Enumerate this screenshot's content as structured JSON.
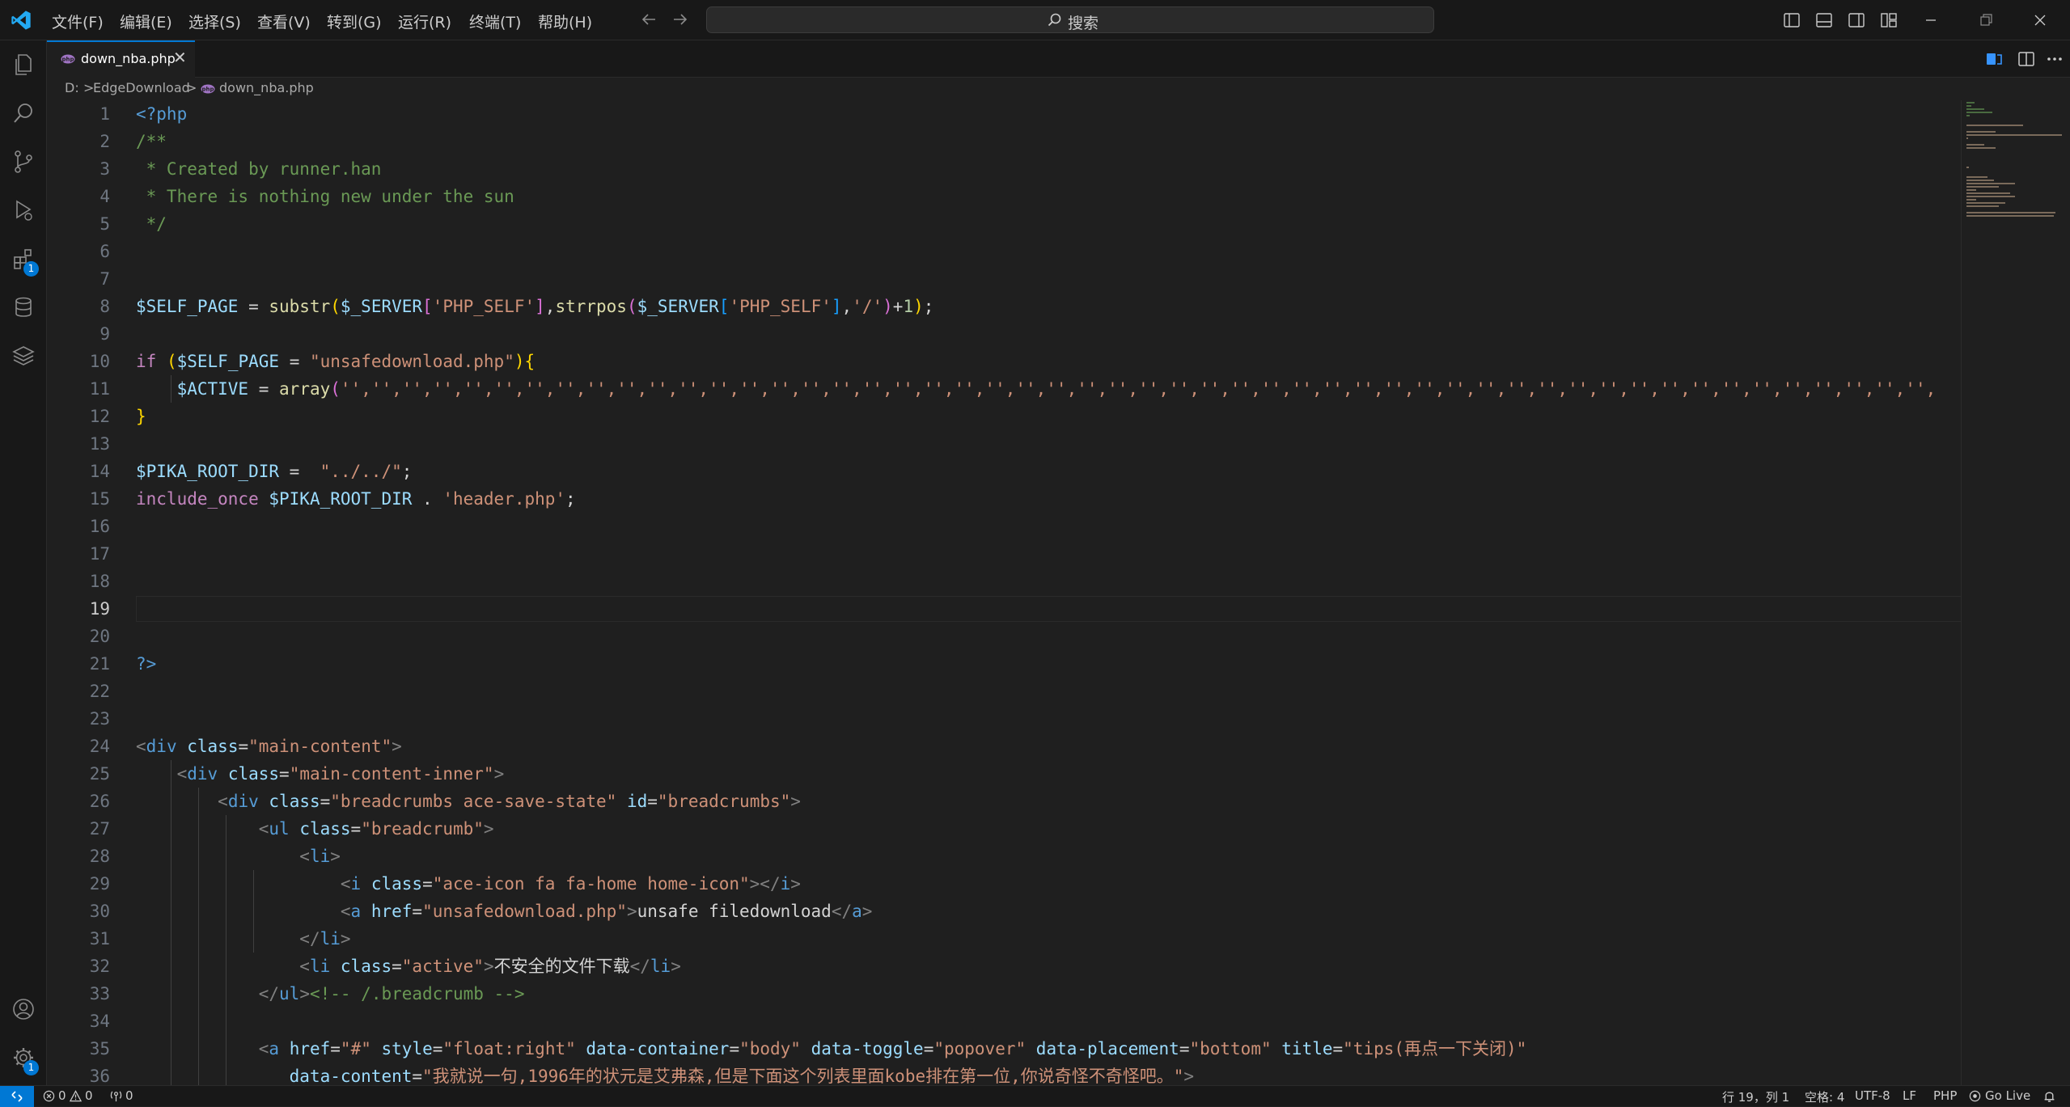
{
  "menu": [
    "文件(F)",
    "编辑(E)",
    "选择(S)",
    "查看(V)",
    "转到(G)",
    "运行(R)",
    "终端(T)",
    "帮助(H)"
  ],
  "search": {
    "label": "搜索"
  },
  "tab": {
    "label": "down_nba.php",
    "close": "✕"
  },
  "breadcrumb": {
    "drive": "D:",
    "folder": "EdgeDownload",
    "file": "down_nba.php",
    "sep": ">"
  },
  "activity": {
    "extensions_badge": "1",
    "settings_badge": "1"
  },
  "editor": {
    "current_line": 19,
    "line_numbers": [
      "1",
      "2",
      "3",
      "4",
      "5",
      "6",
      "7",
      "8",
      "9",
      "10",
      "11",
      "12",
      "13",
      "14",
      "15",
      "16",
      "17",
      "18",
      "19",
      "20",
      "21",
      "22",
      "23",
      "24",
      "25",
      "26",
      "27",
      "28",
      "29",
      "30",
      "31",
      "32",
      "33",
      "34",
      "35",
      "36"
    ],
    "lines": [
      [
        [
          "<?php",
          "#569cd6"
        ]
      ],
      [
        [
          "/**",
          "#6a9955"
        ]
      ],
      [
        [
          " * Created by runner.han",
          "#6a9955"
        ]
      ],
      [
        [
          " * There is nothing new under the sun",
          "#6a9955"
        ]
      ],
      [
        [
          " */",
          "#6a9955"
        ]
      ],
      [],
      [],
      [
        [
          "$SELF_PAGE",
          "#9cdcfe"
        ],
        [
          " = ",
          "#d4d4d4"
        ],
        [
          "substr",
          "#dcdcaa"
        ],
        [
          "(",
          "#ffd700"
        ],
        [
          "$_SERVER",
          "#9cdcfe"
        ],
        [
          "[",
          "#da70d6"
        ],
        [
          "'PHP_SELF'",
          "#ce9178"
        ],
        [
          "]",
          "#da70d6"
        ],
        [
          ",",
          "#d4d4d4"
        ],
        [
          "strrpos",
          "#dcdcaa"
        ],
        [
          "(",
          "#da70d6"
        ],
        [
          "$_SERVER",
          "#9cdcfe"
        ],
        [
          "[",
          "#179fff"
        ],
        [
          "'PHP_SELF'",
          "#ce9178"
        ],
        [
          "]",
          "#179fff"
        ],
        [
          ",",
          "#d4d4d4"
        ],
        [
          "'/'",
          "#ce9178"
        ],
        [
          ")",
          "#da70d6"
        ],
        [
          "+",
          "#d4d4d4"
        ],
        [
          "1",
          "#b5cea8"
        ],
        [
          ")",
          "#ffd700"
        ],
        [
          ";",
          "#d4d4d4"
        ]
      ],
      [],
      [
        [
          "if",
          "#c586c0"
        ],
        [
          " ",
          "#d4d4d4"
        ],
        [
          "(",
          "#ffd700"
        ],
        [
          "$SELF_PAGE",
          "#9cdcfe"
        ],
        [
          " = ",
          "#d4d4d4"
        ],
        [
          "\"unsafedownload.php\"",
          "#ce9178"
        ],
        [
          ")",
          "#ffd700"
        ],
        [
          "{",
          "#ffd700"
        ]
      ],
      [
        [
          "    ",
          "#d4d4d4"
        ],
        [
          "$ACTIVE",
          "#9cdcfe"
        ],
        [
          " = ",
          "#d4d4d4"
        ],
        [
          "array",
          "#dcdcaa"
        ],
        [
          "(",
          "#da70d6"
        ],
        [
          "'','','','','','','','','','','','','','','','','','','','','','','','','','','','','','','','','','','','','','','','','','','','','','','','','','','','',",
          "#ce9178"
        ]
      ],
      [
        [
          "}",
          "#ffd700"
        ]
      ],
      [],
      [
        [
          "$PIKA_ROOT_DIR",
          "#9cdcfe"
        ],
        [
          " =  ",
          "#d4d4d4"
        ],
        [
          "\"../../\"",
          "#ce9178"
        ],
        [
          ";",
          "#d4d4d4"
        ]
      ],
      [
        [
          "include_once",
          "#c586c0"
        ],
        [
          " ",
          "#d4d4d4"
        ],
        [
          "$PIKA_ROOT_DIR",
          "#9cdcfe"
        ],
        [
          " . ",
          "#d4d4d4"
        ],
        [
          "'header.php'",
          "#ce9178"
        ],
        [
          ";",
          "#d4d4d4"
        ]
      ],
      [],
      [],
      [],
      [],
      [],
      [
        [
          "?>",
          "#569cd6"
        ]
      ],
      [],
      [],
      [
        [
          "<",
          "#808080"
        ],
        [
          "div",
          "#569cd6"
        ],
        [
          " ",
          "#d4d4d4"
        ],
        [
          "class",
          "#9cdcfe"
        ],
        [
          "=",
          "#d4d4d4"
        ],
        [
          "\"main-content\"",
          "#ce9178"
        ],
        [
          ">",
          "#808080"
        ]
      ],
      [
        [
          "    ",
          "#d4d4d4"
        ],
        [
          "<",
          "#808080"
        ],
        [
          "div",
          "#569cd6"
        ],
        [
          " ",
          "#d4d4d4"
        ],
        [
          "class",
          "#9cdcfe"
        ],
        [
          "=",
          "#d4d4d4"
        ],
        [
          "\"main-content-inner\"",
          "#ce9178"
        ],
        [
          ">",
          "#808080"
        ]
      ],
      [
        [
          "        ",
          "#d4d4d4"
        ],
        [
          "<",
          "#808080"
        ],
        [
          "div",
          "#569cd6"
        ],
        [
          " ",
          "#d4d4d4"
        ],
        [
          "class",
          "#9cdcfe"
        ],
        [
          "=",
          "#d4d4d4"
        ],
        [
          "\"breadcrumbs ace-save-state\"",
          "#ce9178"
        ],
        [
          " ",
          "#d4d4d4"
        ],
        [
          "id",
          "#9cdcfe"
        ],
        [
          "=",
          "#d4d4d4"
        ],
        [
          "\"breadcrumbs\"",
          "#ce9178"
        ],
        [
          ">",
          "#808080"
        ]
      ],
      [
        [
          "            ",
          "#d4d4d4"
        ],
        [
          "<",
          "#808080"
        ],
        [
          "ul",
          "#569cd6"
        ],
        [
          " ",
          "#d4d4d4"
        ],
        [
          "class",
          "#9cdcfe"
        ],
        [
          "=",
          "#d4d4d4"
        ],
        [
          "\"breadcrumb\"",
          "#ce9178"
        ],
        [
          ">",
          "#808080"
        ]
      ],
      [
        [
          "                ",
          "#d4d4d4"
        ],
        [
          "<",
          "#808080"
        ],
        [
          "li",
          "#569cd6"
        ],
        [
          ">",
          "#808080"
        ]
      ],
      [
        [
          "                    ",
          "#d4d4d4"
        ],
        [
          "<",
          "#808080"
        ],
        [
          "i",
          "#569cd6"
        ],
        [
          " ",
          "#d4d4d4"
        ],
        [
          "class",
          "#9cdcfe"
        ],
        [
          "=",
          "#d4d4d4"
        ],
        [
          "\"ace-icon fa fa-home home-icon\"",
          "#ce9178"
        ],
        [
          "></",
          "#808080"
        ],
        [
          "i",
          "#569cd6"
        ],
        [
          ">",
          "#808080"
        ]
      ],
      [
        [
          "                    ",
          "#d4d4d4"
        ],
        [
          "<",
          "#808080"
        ],
        [
          "a",
          "#569cd6"
        ],
        [
          " ",
          "#d4d4d4"
        ],
        [
          "href",
          "#9cdcfe"
        ],
        [
          "=",
          "#d4d4d4"
        ],
        [
          "\"unsafedownload.php\"",
          "#ce9178"
        ],
        [
          ">",
          "#808080"
        ],
        [
          "unsafe filedownload",
          "#d4d4d4"
        ],
        [
          "</",
          "#808080"
        ],
        [
          "a",
          "#569cd6"
        ],
        [
          ">",
          "#808080"
        ]
      ],
      [
        [
          "                ",
          "#d4d4d4"
        ],
        [
          "</",
          "#808080"
        ],
        [
          "li",
          "#569cd6"
        ],
        [
          ">",
          "#808080"
        ]
      ],
      [
        [
          "                ",
          "#d4d4d4"
        ],
        [
          "<",
          "#808080"
        ],
        [
          "li",
          "#569cd6"
        ],
        [
          " ",
          "#d4d4d4"
        ],
        [
          "class",
          "#9cdcfe"
        ],
        [
          "=",
          "#d4d4d4"
        ],
        [
          "\"active\"",
          "#ce9178"
        ],
        [
          ">",
          "#808080"
        ],
        [
          "不安全的文件下载",
          "#d4d4d4"
        ],
        [
          "</",
          "#808080"
        ],
        [
          "li",
          "#569cd6"
        ],
        [
          ">",
          "#808080"
        ]
      ],
      [
        [
          "            ",
          "#d4d4d4"
        ],
        [
          "</",
          "#808080"
        ],
        [
          "ul",
          "#569cd6"
        ],
        [
          ">",
          "#808080"
        ],
        [
          "<!-- /.breadcrumb -->",
          "#6a9955"
        ]
      ],
      [],
      [
        [
          "            ",
          "#d4d4d4"
        ],
        [
          "<",
          "#808080"
        ],
        [
          "a",
          "#569cd6"
        ],
        [
          " ",
          "#d4d4d4"
        ],
        [
          "href",
          "#9cdcfe"
        ],
        [
          "=",
          "#d4d4d4"
        ],
        [
          "\"#\"",
          "#ce9178"
        ],
        [
          " ",
          "#d4d4d4"
        ],
        [
          "style",
          "#9cdcfe"
        ],
        [
          "=",
          "#d4d4d4"
        ],
        [
          "\"float:right\"",
          "#ce9178"
        ],
        [
          " ",
          "#d4d4d4"
        ],
        [
          "data-container",
          "#9cdcfe"
        ],
        [
          "=",
          "#d4d4d4"
        ],
        [
          "\"body\"",
          "#ce9178"
        ],
        [
          " ",
          "#d4d4d4"
        ],
        [
          "data-toggle",
          "#9cdcfe"
        ],
        [
          "=",
          "#d4d4d4"
        ],
        [
          "\"popover\"",
          "#ce9178"
        ],
        [
          " ",
          "#d4d4d4"
        ],
        [
          "data-placement",
          "#9cdcfe"
        ],
        [
          "=",
          "#d4d4d4"
        ],
        [
          "\"bottom\"",
          "#ce9178"
        ],
        [
          " ",
          "#d4d4d4"
        ],
        [
          "title",
          "#9cdcfe"
        ],
        [
          "=",
          "#d4d4d4"
        ],
        [
          "\"tips(再点一下关闭)\"",
          "#ce9178"
        ]
      ],
      [
        [
          "               ",
          "#d4d4d4"
        ],
        [
          "data-content",
          "#9cdcfe"
        ],
        [
          "=",
          "#d4d4d4"
        ],
        [
          "\"我就说一句,1996年的状元是艾弗森,但是下面这个列表里面kobe排在第一位,你说奇怪不奇怪吧。\"",
          "#ce9178"
        ],
        [
          ">",
          "#808080"
        ]
      ]
    ]
  },
  "status": {
    "errors": "0",
    "warnings": "0",
    "ports": "0",
    "position": "行 19，列 1",
    "spaces": "空格: 4",
    "encoding": "UTF-8",
    "eol": "LF",
    "language": "PHP",
    "golive": "Go Live"
  },
  "colors": {
    "accent": "#0078d4",
    "editor_bg": "#1f1f1f",
    "chrome_bg": "#181818"
  },
  "icons": [
    "vscode-logo-icon",
    "back-arrow-icon",
    "forward-arrow-icon",
    "search-icon",
    "toggle-primary-sidebar-icon",
    "toggle-panel-icon",
    "toggle-secondary-sidebar-icon",
    "customize-layout-icon",
    "minimize-icon",
    "restore-icon",
    "close-window-icon",
    "explorer-icon",
    "search-view-icon",
    "source-control-icon",
    "run-debug-icon",
    "extensions-icon",
    "database-icon",
    "layers-icon",
    "account-icon",
    "settings-gear-icon",
    "php-file-icon",
    "compare-icon",
    "split-editor-icon",
    "more-actions-icon",
    "remote-icon",
    "error-icon",
    "warning-icon",
    "ports-icon",
    "golive-icon",
    "bell-icon"
  ]
}
